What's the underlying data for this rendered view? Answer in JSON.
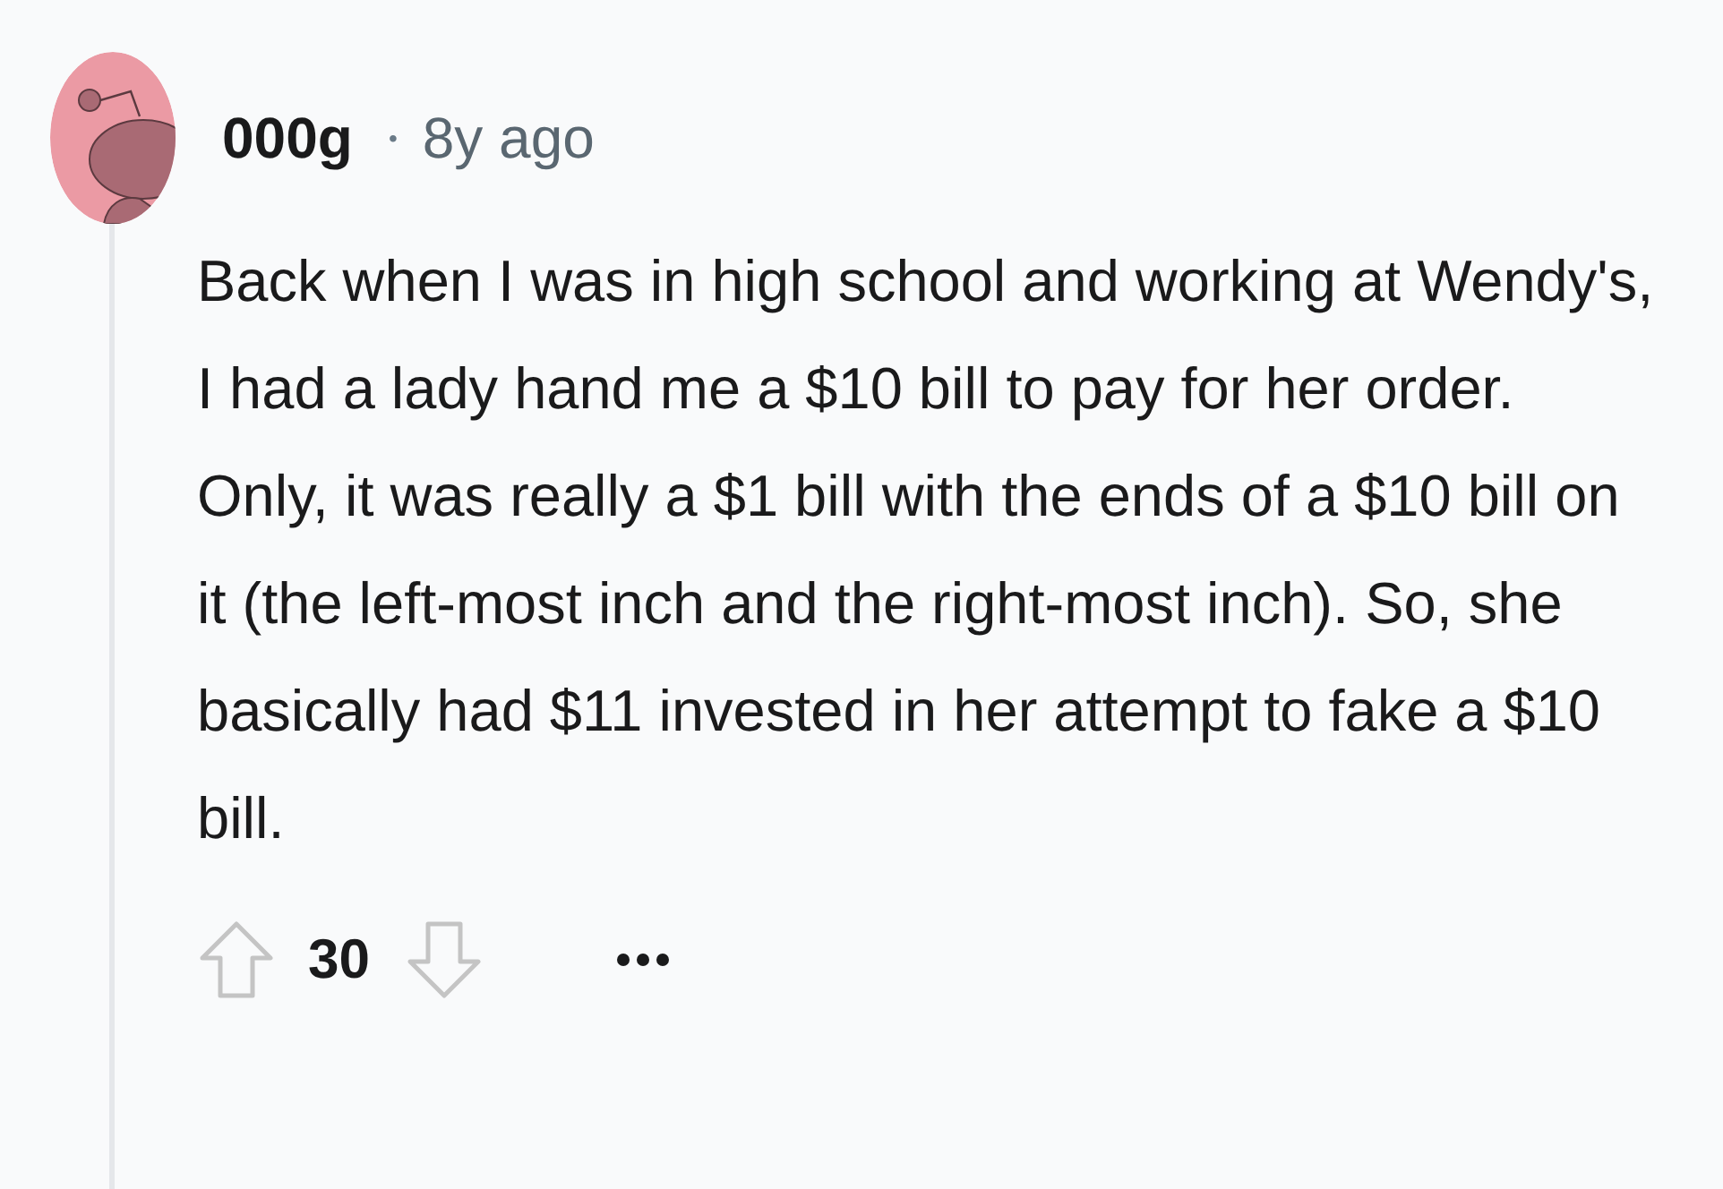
{
  "comment": {
    "author": "000g",
    "separator": "•",
    "time": "8y ago",
    "body": "Back when I was in high school and working at Wendy's, I had a lady hand me a $10 bill to pay for her order. Only, it was really a $1 bill with the ends of a $10 bill on it (the left-most inch and the right-most inch). So, she basically had $11 invested in her attempt to fake a $10 bill.",
    "score": "30"
  }
}
